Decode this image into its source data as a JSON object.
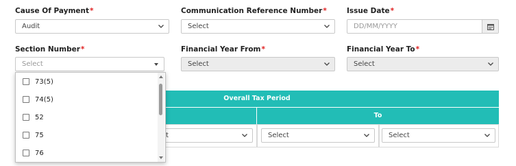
{
  "row1": {
    "cause_label": "Cause Of Payment",
    "cause_value": "Audit",
    "comm_label": "Communication Reference Number",
    "comm_value": "Select",
    "issue_label": "Issue Date",
    "issue_placeholder": "DD/MM/YYYY"
  },
  "row2": {
    "section_label": "Section Number",
    "section_value": "Select",
    "fy_from_label": "Financial Year From",
    "fy_from_value": "Select",
    "fy_to_label": "Financial Year To",
    "fy_to_value": "Select"
  },
  "required_marker": "*",
  "tax_period": {
    "title": "Overall Tax Period",
    "to_label": "To",
    "from_month_partial": "t",
    "to_month": "Select",
    "to_year": "Select"
  },
  "section_options": [
    "73(5)",
    "74(5)",
    "52",
    "75",
    "76"
  ],
  "colors": {
    "accent": "#22bdb6",
    "required": "#e02020"
  },
  "icons": {
    "chevron": "chevron-down-icon",
    "calendar": "calendar-icon"
  }
}
